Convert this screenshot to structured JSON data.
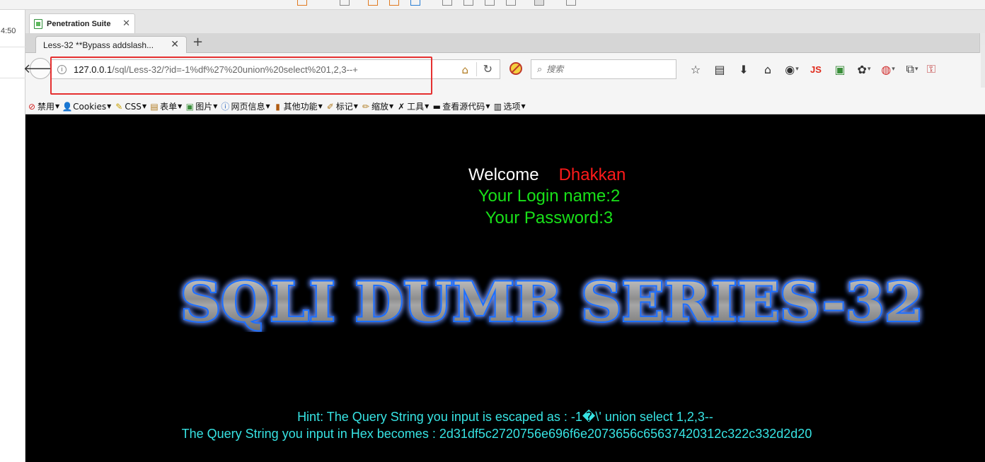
{
  "os": {
    "clock": "4:50"
  },
  "app": {
    "title": "Penetration Suite",
    "close_glyph": "✕"
  },
  "tabs": [
    {
      "label": "Less-32 **Bypass addslash...",
      "close_glyph": "✕"
    }
  ],
  "new_tab_glyph": "+",
  "url": {
    "host": "127.0.0.1",
    "path": "/sql/Less-32/?id=-1%df%27%20union%20select%201,2,3--+"
  },
  "search": {
    "placeholder": "搜索"
  },
  "nav_icons": [
    "bookmark-star-icon",
    "reading-list-icon",
    "download-icon",
    "home-icon",
    "globe-icon",
    "js-icon",
    "image-tool-icon",
    "palette-icon",
    "hackbar-icon",
    "responsive-icon",
    "key-icon"
  ],
  "js_label": "JS",
  "dev_toolbar": [
    {
      "label": "禁用",
      "icon": "no-entry-icon"
    },
    {
      "label": "Cookies",
      "icon": "user-icon"
    },
    {
      "label": "CSS",
      "icon": "wand-icon"
    },
    {
      "label": "表单",
      "icon": "form-icon"
    },
    {
      "label": "图片",
      "icon": "image-icon"
    },
    {
      "label": "网页信息",
      "icon": "info-icon"
    },
    {
      "label": "其他功能",
      "icon": "book-icon"
    },
    {
      "label": "标记",
      "icon": "pencil-icon"
    },
    {
      "label": "缩放",
      "icon": "resize-icon"
    },
    {
      "label": "工具",
      "icon": "tools-icon"
    },
    {
      "label": "查看源代码",
      "icon": "terminal-icon"
    },
    {
      "label": "选项",
      "icon": "options-icon"
    }
  ],
  "page": {
    "welcome": "Welcome",
    "user": "Dhakkan",
    "login_name": "Your Login name:2",
    "password": "Your Password:3",
    "logo_text": "SQLI DUMB SERIES-32",
    "hint_escaped": "Hint: The Query String you input is escaped as : -1�\\' union select 1,2,3--",
    "hint_hex": "The Query String you input in Hex becomes : 2d31df5c2720756e696f6e2073656c65637420312c322c332d2d20"
  },
  "colors": {
    "welcome": "#ffffff",
    "user": "#ff1a1a",
    "green_text": "#19e019",
    "hint_text": "#37e3e3",
    "highlight_box": "#e53030",
    "logo_glow": "#1e6fff"
  }
}
